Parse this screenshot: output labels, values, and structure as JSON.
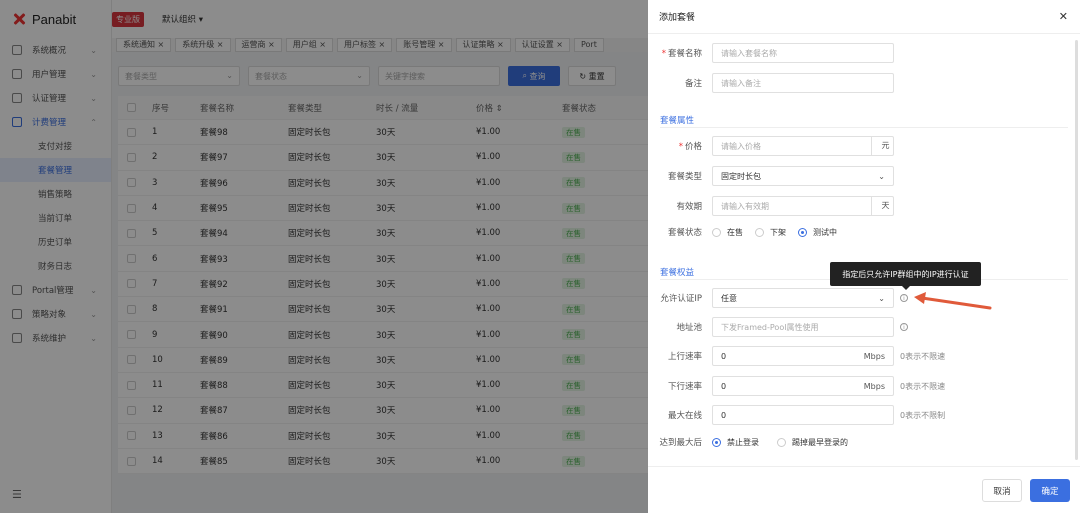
{
  "app": {
    "brand": "Panabit",
    "edition": "专业版",
    "org": "默认组织 ▾"
  },
  "sidebar": {
    "items": [
      {
        "label": "系统概况"
      },
      {
        "label": "用户管理"
      },
      {
        "label": "认证管理"
      },
      {
        "label": "计费管理"
      }
    ],
    "sub_items": [
      {
        "label": "支付对接"
      },
      {
        "label": "套餐管理"
      },
      {
        "label": "销售策略"
      },
      {
        "label": "当前订单"
      },
      {
        "label": "历史订单"
      },
      {
        "label": "财务日志"
      }
    ],
    "items2": [
      {
        "label": "Portal管理"
      },
      {
        "label": "策略对象"
      },
      {
        "label": "系统维护"
      }
    ]
  },
  "tabs": [
    "系统通知 ×",
    "系统升级 ×",
    "运营商 ×",
    "用户组 ×",
    "用户标签 ×",
    "账号管理 ×",
    "认证策略 ×",
    "认证设置 ×",
    "Port"
  ],
  "filters": {
    "type": "套餐类型",
    "status": "套餐状态",
    "keyword": "关键字搜索",
    "query": "查询",
    "reset": "重置"
  },
  "table": {
    "headers": [
      "序号",
      "套餐名称",
      "套餐类型",
      "时长 / 流量",
      "价格 ⇕",
      "套餐状态"
    ],
    "rows": [
      [
        "1",
        "套餐98",
        "固定时长包",
        "30天",
        "¥1.00",
        "在售"
      ],
      [
        "2",
        "套餐97",
        "固定时长包",
        "30天",
        "¥1.00",
        "在售"
      ],
      [
        "3",
        "套餐96",
        "固定时长包",
        "30天",
        "¥1.00",
        "在售"
      ],
      [
        "4",
        "套餐95",
        "固定时长包",
        "30天",
        "¥1.00",
        "在售"
      ],
      [
        "5",
        "套餐94",
        "固定时长包",
        "30天",
        "¥1.00",
        "在售"
      ],
      [
        "6",
        "套餐93",
        "固定时长包",
        "30天",
        "¥1.00",
        "在售"
      ],
      [
        "7",
        "套餐92",
        "固定时长包",
        "30天",
        "¥1.00",
        "在售"
      ],
      [
        "8",
        "套餐91",
        "固定时长包",
        "30天",
        "¥1.00",
        "在售"
      ],
      [
        "9",
        "套餐90",
        "固定时长包",
        "30天",
        "¥1.00",
        "在售"
      ],
      [
        "10",
        "套餐89",
        "固定时长包",
        "30天",
        "¥1.00",
        "在售"
      ],
      [
        "11",
        "套餐88",
        "固定时长包",
        "30天",
        "¥1.00",
        "在售"
      ],
      [
        "12",
        "套餐87",
        "固定时长包",
        "30天",
        "¥1.00",
        "在售"
      ],
      [
        "13",
        "套餐86",
        "固定时长包",
        "30天",
        "¥1.00",
        "在售"
      ],
      [
        "14",
        "套餐85",
        "固定时长包",
        "30天",
        "¥1.00",
        "在售"
      ]
    ]
  },
  "drawer": {
    "title": "添加套餐",
    "name_label": "套餐名称",
    "name_placeholder": "请输入套餐名称",
    "remark_label": "备注",
    "remark_placeholder": "请输入备注",
    "section_attr": "套餐属性",
    "price_label": "价格",
    "price_placeholder": "请输入价格",
    "price_unit": "元",
    "type_label": "套餐类型",
    "type_value": "固定时长包",
    "valid_label": "有效期",
    "valid_placeholder": "请输入有效期",
    "valid_unit": "天",
    "status_label": "套餐状态",
    "status_opts": [
      "在售",
      "下架",
      "测试中"
    ],
    "section_rights": "套餐权益",
    "ip_label": "允许认证IP",
    "ip_value": "任意",
    "tooltip": "指定后只允许IP群组中的IP进行认证",
    "pool_label": "地址池",
    "pool_placeholder": "下发Framed-Pool属性使用",
    "up_label": "上行速率",
    "up_value": "0",
    "up_unit": "Mbps",
    "up_hint": "0表示不限速",
    "down_label": "下行速率",
    "down_value": "0",
    "down_unit": "Mbps",
    "down_hint": "0表示不限速",
    "max_label": "最大在线",
    "max_value": "0",
    "max_hint": "0表示不限制",
    "reach_label": "达到最大后",
    "reach_opts": [
      "禁止登录",
      "踢掉最早登录的"
    ],
    "cancel": "取消",
    "ok": "确定"
  },
  "colors": {
    "accent": "#3b6fe0",
    "annotation_arrow": "#e05a3a"
  }
}
